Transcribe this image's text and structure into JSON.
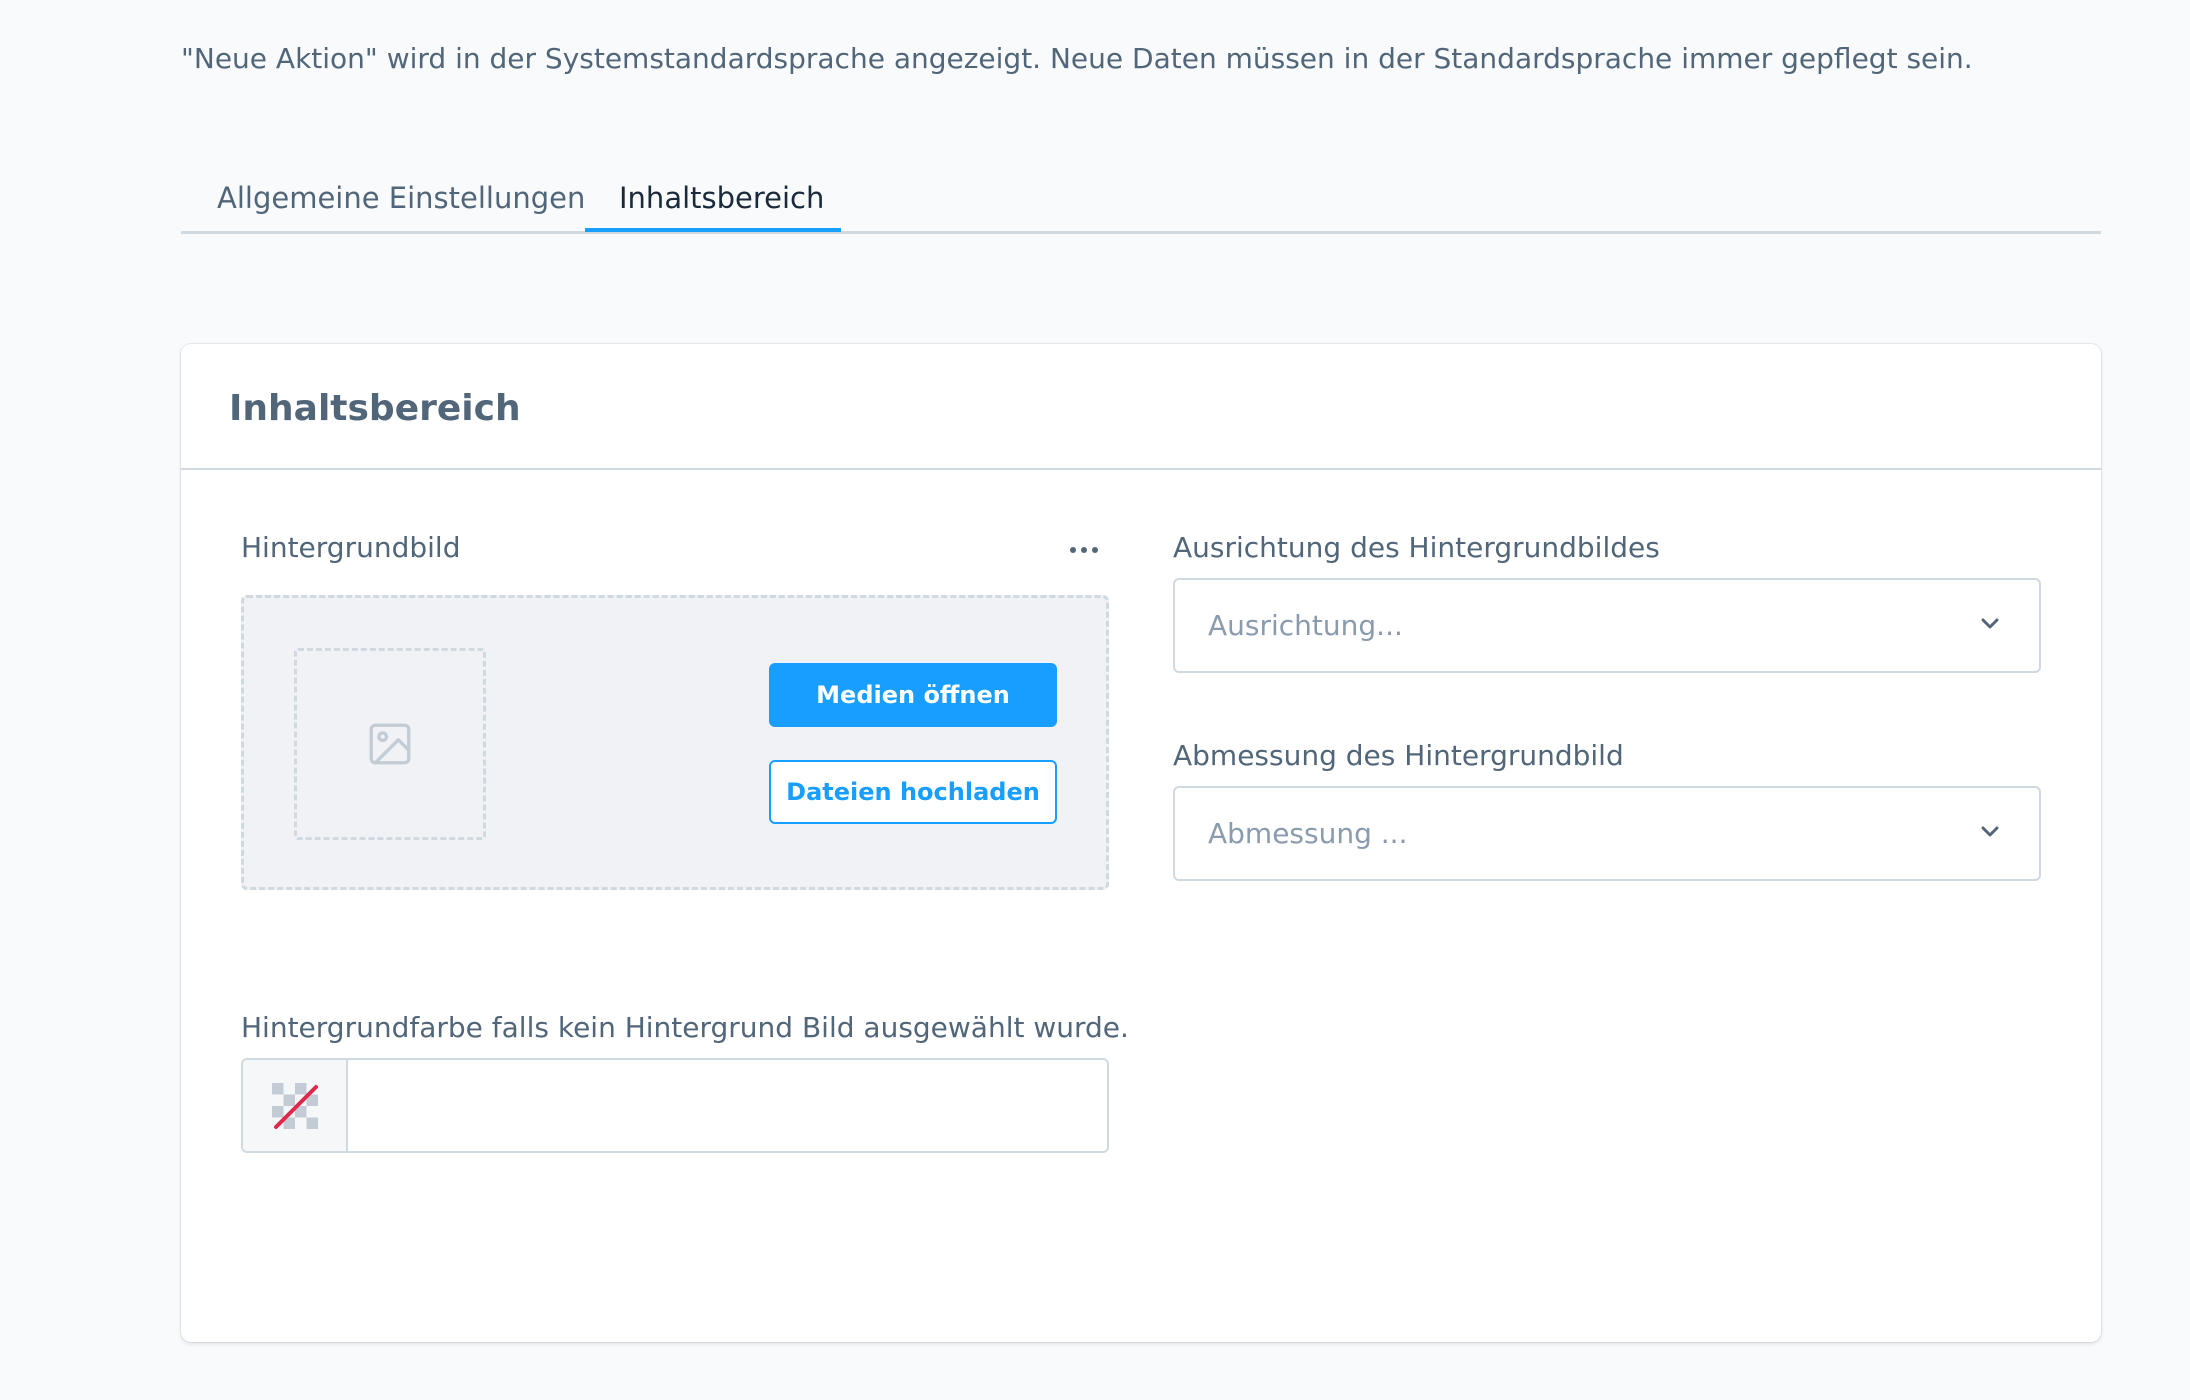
{
  "info_text": "\"Neue Aktion\" wird in der Systemstandardsprache angezeigt. Neue Daten müssen in der Standardsprache immer gepflegt sein.",
  "tabs": [
    {
      "label": "Allgemeine Einstellungen",
      "active": false
    },
    {
      "label": "Inhaltsbereich",
      "active": true
    }
  ],
  "card": {
    "title": "Inhaltsbereich",
    "background_image": {
      "label": "Hintergrundbild",
      "open_media_label": "Medien öffnen",
      "upload_label": "Dateien hochladen"
    },
    "alignment": {
      "label": "Ausrichtung des Hintergrundbildes",
      "placeholder": "Ausrichtung..."
    },
    "dimension": {
      "label": "Abmessung des Hintergrundbild",
      "placeholder": "Abmessung ..."
    },
    "background_color": {
      "label": "Hintergrundfarbe falls kein Hintergrund Bild ausgewählt wurde.",
      "value": ""
    }
  },
  "colors": {
    "accent": "#189eff",
    "text": "#52667a",
    "border": "#d1d9e0",
    "no_color_slash": "#de294c"
  },
  "icons": {
    "context_menu": "more-horizontal-icon",
    "image_placeholder": "image-icon",
    "select_chevron": "chevron-down-icon",
    "no_color": "no-color-swatch-icon"
  }
}
